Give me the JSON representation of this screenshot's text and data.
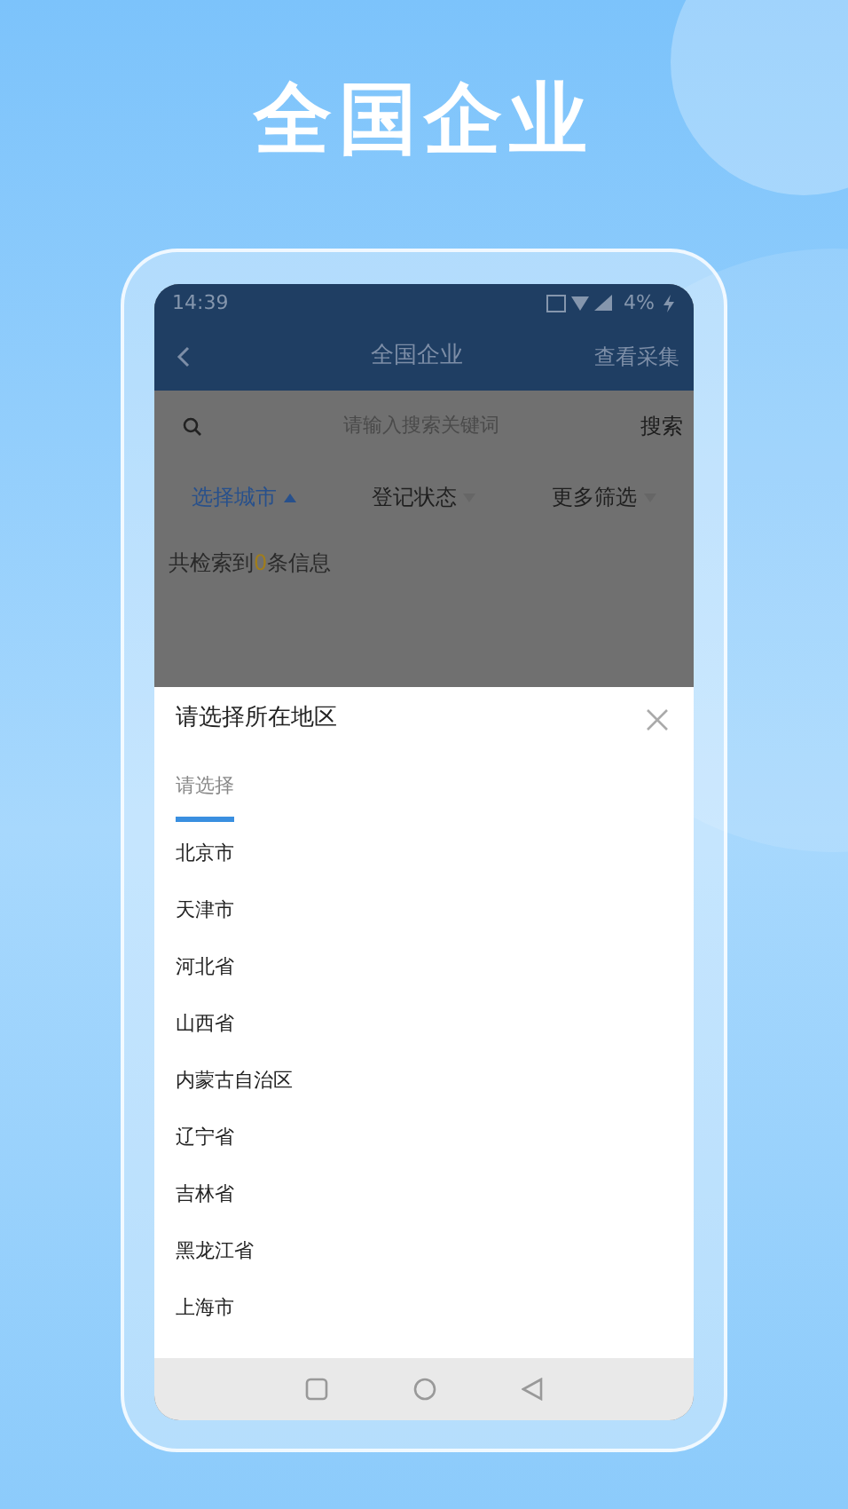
{
  "headline": "全国企业",
  "status_bar": {
    "time": "14:39",
    "battery": "4%"
  },
  "app_bar": {
    "title": "全国企业",
    "action": "查看采集"
  },
  "search": {
    "placeholder": "请输入搜索关键词",
    "button": "搜索"
  },
  "filters": [
    {
      "label": "选择城市",
      "selected": true
    },
    {
      "label": "登记状态",
      "selected": false
    },
    {
      "label": "更多筛选",
      "selected": false
    }
  ],
  "result": {
    "prefix": "共检索到",
    "count": "0",
    "suffix": "条信息"
  },
  "sheet": {
    "title": "请选择所在地区",
    "tabs": [
      {
        "label": "请选择",
        "selected": true
      }
    ],
    "regions": [
      "北京市",
      "天津市",
      "河北省",
      "山西省",
      "内蒙古自治区",
      "辽宁省",
      "吉林省",
      "黑龙江省",
      "上海市"
    ]
  }
}
